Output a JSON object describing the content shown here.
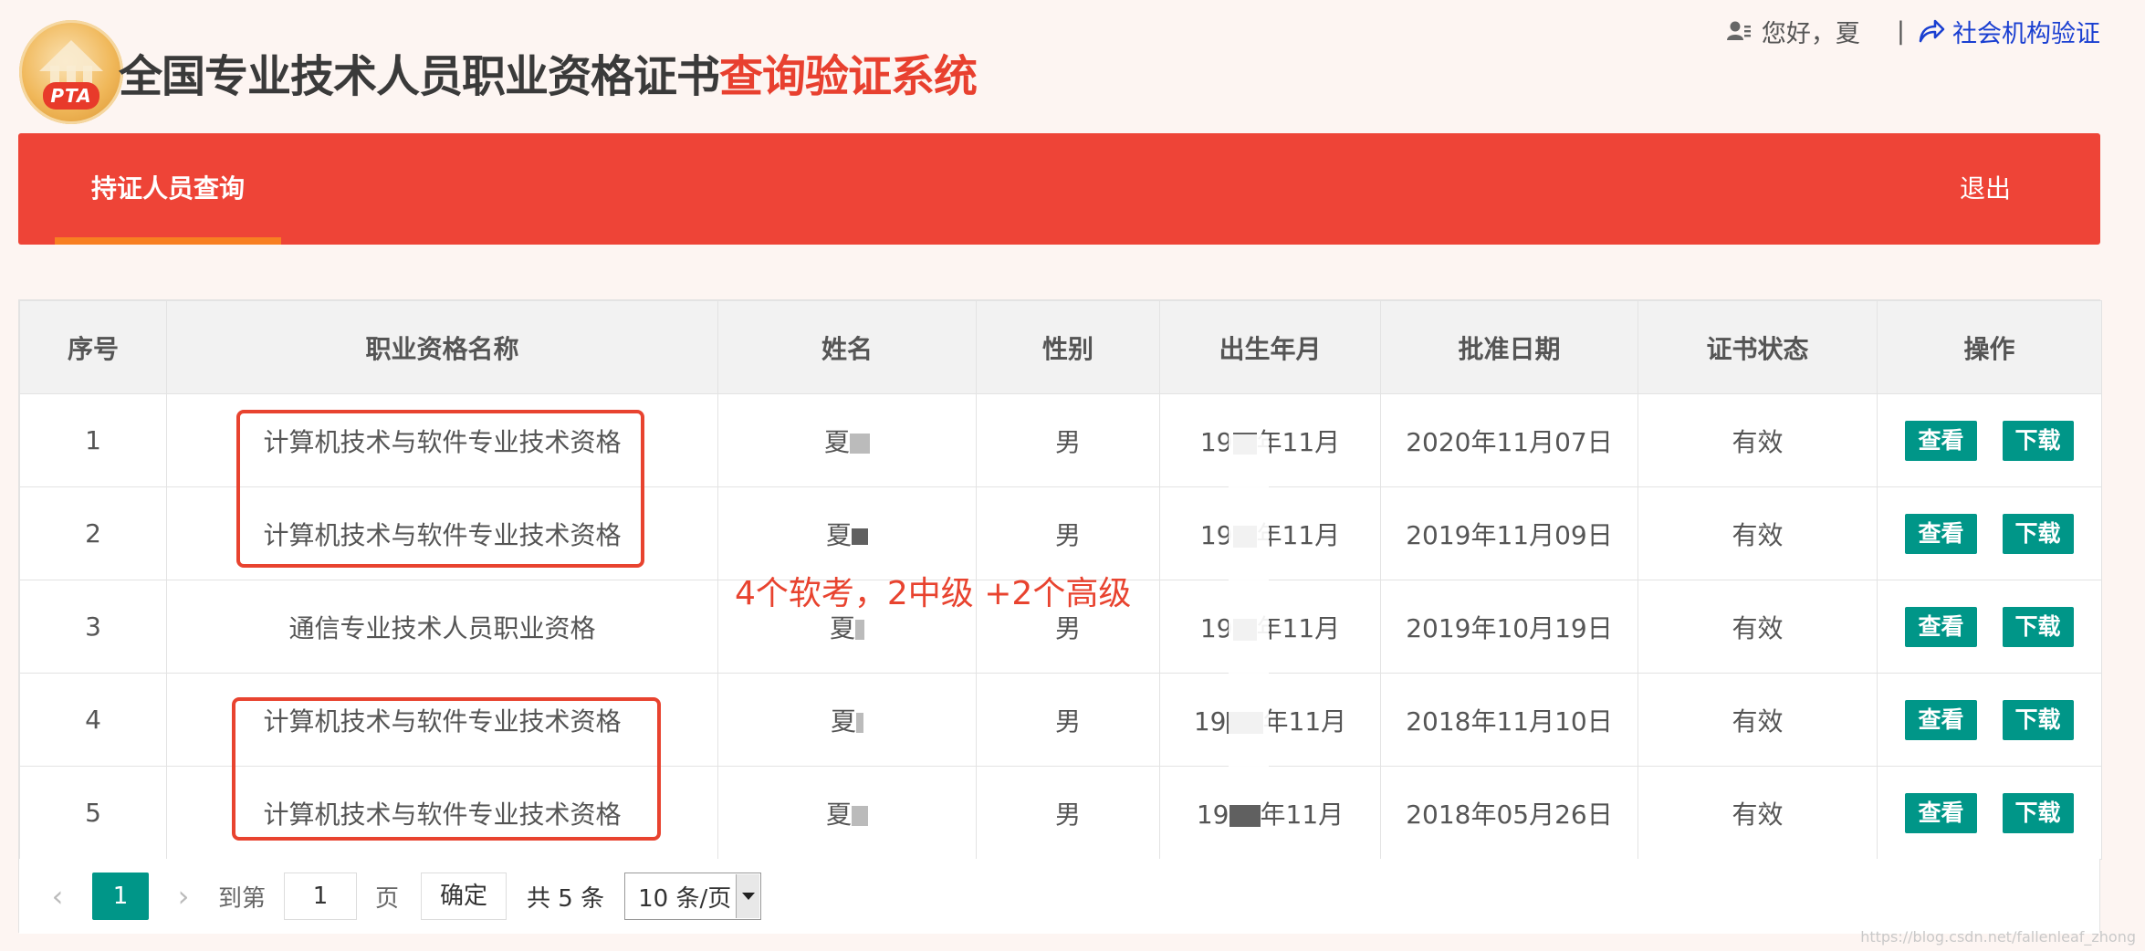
{
  "header": {
    "logo_text": "PTA",
    "title_part1": "全国专业技术人员职业资格证书",
    "title_part2": "查询验证系统",
    "greeting": "您好，夏",
    "separator": "|",
    "org_link": "社会机构验证"
  },
  "nav": {
    "tab_label": "持证人员查询",
    "logout_label": "退出"
  },
  "table": {
    "headers": [
      "序号",
      "职业资格名称",
      "姓名",
      "性别",
      "出生年月",
      "批准日期",
      "证书状态",
      "操作"
    ],
    "rows": [
      {
        "no": "1",
        "name": "计算机技术与软件专业技术资格",
        "person": "夏",
        "gender": "男",
        "birth_pre": "19",
        "birth_post": "年11月",
        "date": "2020年11月07日",
        "status": "有效",
        "view": "查看",
        "download": "下载"
      },
      {
        "no": "2",
        "name": "计算机技术与软件专业技术资格",
        "person": "夏",
        "gender": "男",
        "birth_pre": "19",
        "birth_post": "年11月",
        "date": "2019年11月09日",
        "status": "有效",
        "view": "查看",
        "download": "下载"
      },
      {
        "no": "3",
        "name": "通信专业技术人员职业资格",
        "person": "夏",
        "gender": "男",
        "birth_pre": "19",
        "birth_post": "年11月",
        "date": "2019年10月19日",
        "status": "有效",
        "view": "查看",
        "download": "下载"
      },
      {
        "no": "4",
        "name": "计算机技术与软件专业技术资格",
        "person": "夏",
        "gender": "男",
        "birth_pre": "19",
        "birth_post": "年11月",
        "date": "2018年11月10日",
        "status": "有效",
        "view": "查看",
        "download": "下载"
      },
      {
        "no": "5",
        "name": "计算机技术与软件专业技术资格",
        "person": "夏",
        "gender": "男",
        "birth_pre": "19",
        "birth_post": "年11月",
        "date": "2018年05月26日",
        "status": "有效",
        "view": "查看",
        "download": "下载"
      }
    ]
  },
  "pager": {
    "prev": "‹",
    "current_page": "1",
    "next": "›",
    "goto_label": "到第",
    "goto_value": "1",
    "page_label": "页",
    "confirm_label": "确定",
    "total_label": "共 5 条",
    "page_size": "10 条/页"
  },
  "annotation": {
    "text": "4个软考，2中级 +2个高级"
  },
  "watermark": "https://blog.csdn.net/fallenleaf_zhong",
  "colors": {
    "nav_red": "#ee4437",
    "accent_orange": "#f87f22",
    "button_teal": "#009688",
    "annotation_red": "#e8432f"
  }
}
